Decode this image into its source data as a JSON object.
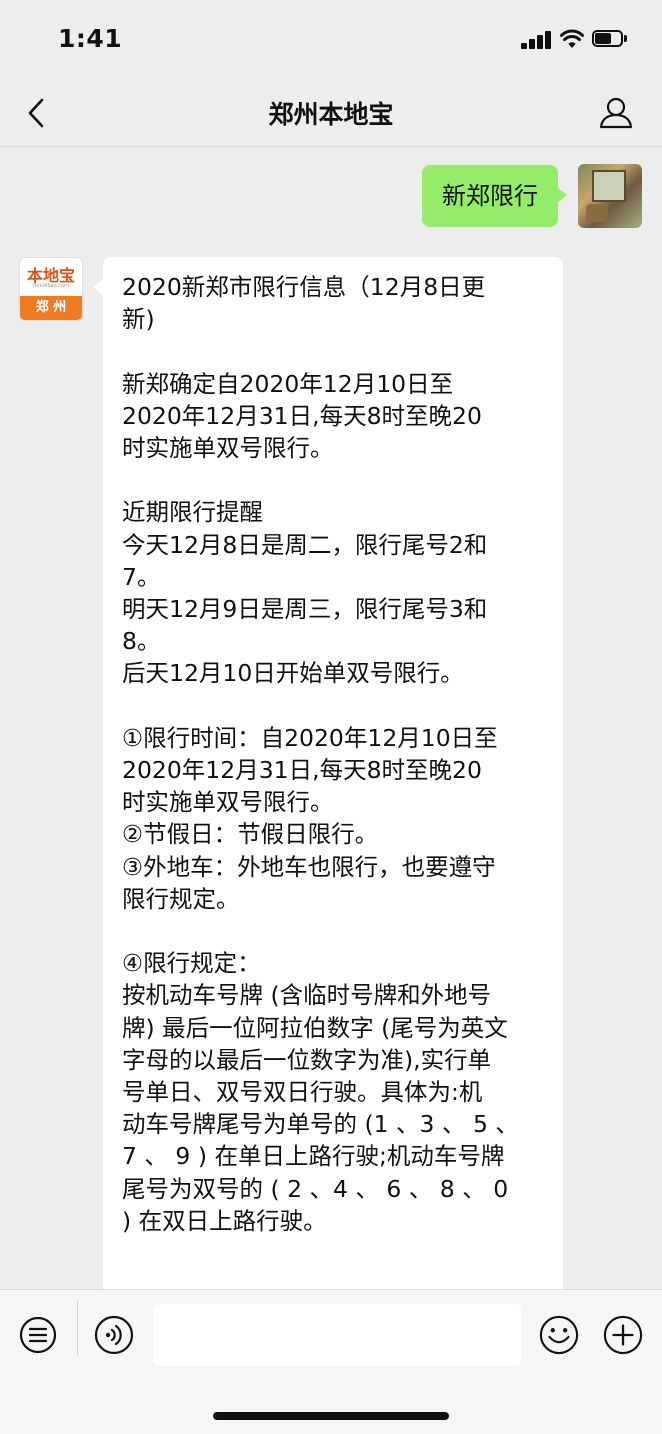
{
  "status_bar": {
    "time": "1:41"
  },
  "nav": {
    "title": "郑州本地宝"
  },
  "chat": {
    "outgoing": {
      "text": "新郑限行"
    },
    "bot_avatar": {
      "logo_text": "本地宝",
      "logo_url": "Bendibao.com",
      "city": "郑 州"
    },
    "incoming_lines": [
      "2020新郑市限行信息（12月8日更",
      "新)",
      "",
      "新郑确定自2020年12月10日至",
      "2020年12月31日,每天8时至晚20",
      "时实施单双号限行。",
      "",
      "近期限行提醒",
      "今天12月8日是周二，限行尾号2和",
      "7。",
      "明天12月9日是周三，限行尾号3和",
      "8。",
      "后天12月10日开始单双号限行。",
      "",
      "①限行时间：自2020年12月10日至",
      "2020年12月31日,每天8时至晚20",
      "时实施单双号限行。",
      "②节假日：节假日限行。",
      "③外地车：外地车也限行，也要遵守",
      "限行规定。",
      "",
      "④限行规定：",
      "按机动车号牌 (含临时号牌和外地号",
      "牌) 最后一位阿拉伯数字 (尾号为英文",
      "字母的以最后一位数字为准),实行单",
      "号单日、双号双日行驶。具体为:机",
      "动车号牌尾号为单号的 (1 、3 、 5 、",
      "7 、 9 ) 在单日上路行驶;机动车号牌",
      "尾号为双号的 ( 2 、4 、 6 、 8 、 0",
      ") 在双日上路行驶。"
    ]
  },
  "input_bar": {
    "placeholder": ""
  },
  "icons": {
    "back": "chevron-left-icon",
    "profile": "person-icon",
    "menu": "list-icon",
    "voice": "voice-icon",
    "emoji": "emoji-icon",
    "add": "plus-icon"
  },
  "colors": {
    "outgoing_bubble": "#95ec69",
    "background": "#ededed",
    "logo_orange": "#f07a1f"
  }
}
